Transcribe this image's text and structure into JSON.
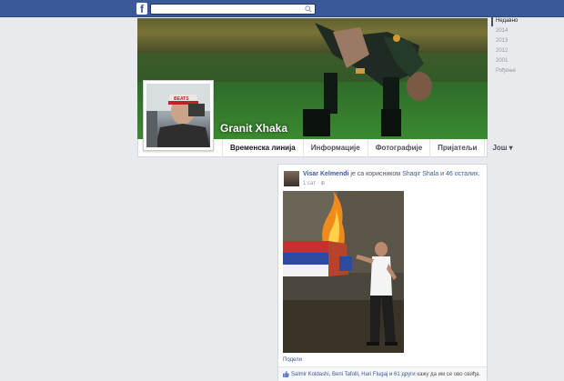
{
  "topbar": {
    "logo": "f",
    "search_placeholder": ""
  },
  "profile": {
    "name": "Granit Xhaka",
    "avatar_cap_text": "BEATS",
    "tabs": [
      "Временска линија",
      "Информације",
      "Фотографије",
      "Пријатељи",
      "Још ▾"
    ],
    "active_tab": 0
  },
  "timeline_years": [
    "Недавно",
    "2014",
    "2013",
    "2012",
    "2001",
    "Рођење"
  ],
  "post": {
    "author": "Visar Kelmendi",
    "with_text": "је са корисником",
    "tagged": "Shaqir Shala",
    "and_text": "и",
    "others": "46 осталих.",
    "time": "1 сат · ⊕",
    "share": "Подели",
    "likes_names": "Salmir Koldashi, Beni Tafolli, Hari Flugaj",
    "likes_and": "и",
    "likes_others": "61 други",
    "likes_suffix": "кажу да им се ово свиђа."
  },
  "colors": {
    "brand": "#3b5998",
    "background": "#e9eaed",
    "link": "#3b5998"
  }
}
